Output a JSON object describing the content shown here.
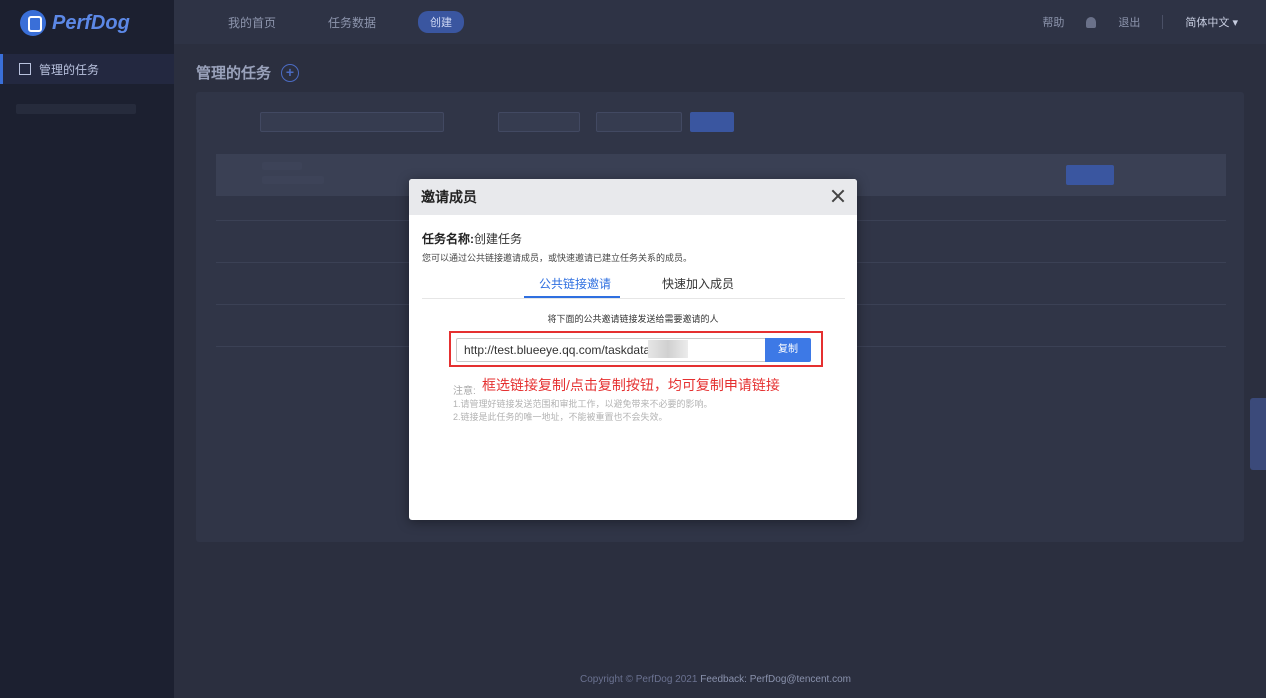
{
  "app": {
    "logo_text": "PerfDog"
  },
  "sidebar": {
    "items": [
      {
        "label": "管理的任务",
        "icon": "task-list-icon"
      }
    ]
  },
  "topbar": {
    "tabs": [
      "我的首页",
      "任务数据"
    ],
    "active_pill": "创建",
    "right_items": [
      "帮助",
      "退出"
    ],
    "language": "简体中文 ▾"
  },
  "page": {
    "title": "管理的任务"
  },
  "footer": {
    "text": "Copyright © PerfDog 2021 ",
    "feedback": "Feedback: PerfDog@tencent.com"
  },
  "modal": {
    "title": "邀请成员",
    "task_name_key": "任务名称:",
    "task_name_value": "创建任务",
    "description": "您可以通过公共链接邀请成员，或快速邀请已建立任务关系的成员。",
    "tabs": [
      {
        "label": "公共链接邀请",
        "active": true
      },
      {
        "label": "快速加入成员",
        "active": false
      }
    ],
    "hint": "将下面的公共邀请链接发送给需要邀请的人",
    "link_value": "http://test.blueeye.qq.com/taskdata/",
    "copy_button": "复制",
    "note_label": "注意:",
    "annotation": "框选链接复制/点击复制按钮，均可复制申请链接",
    "notes": [
      "1.请管理好链接发送范围和审批工作，以避免带来不必要的影响。",
      "2.链接是此任务的唯一地址，不能被重置也不会失效。"
    ],
    "colors": {
      "accent": "#3d79e6",
      "annotation": "#e53030"
    }
  }
}
